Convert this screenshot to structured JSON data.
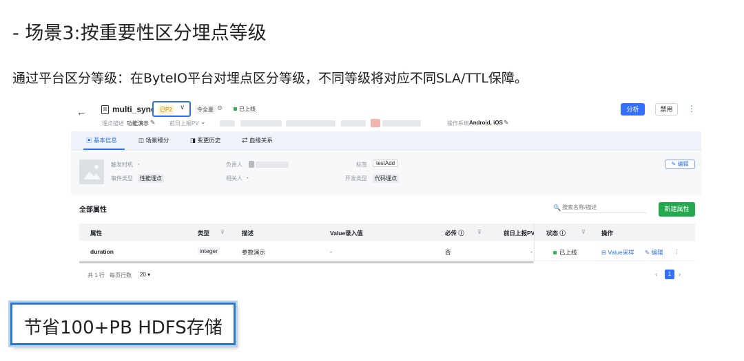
{
  "slide": {
    "title": "- 场景3:按重要性区分埋点等级",
    "subtitle": "通过平台区分等级：在ByteIO平台对埋点区分等级，不同等级将对应不同SLA/TTL保障。",
    "callout": "节省100+PB HDFS存储"
  },
  "header": {
    "back_icon": "←",
    "event_name": "multi_sync",
    "level": "已P2",
    "level_chevron": "∨",
    "scope": "令全量",
    "settings_icon": "⚙",
    "status": "已上线",
    "desc_label": "埋点描述",
    "desc_value": "功能演示",
    "pv_label": "前日上报PV",
    "pv_chevron": "⌄",
    "os_label": "操作系统",
    "os_value": "Android, iOS",
    "analyze_button": "分析",
    "disable_button": "禁用",
    "more_icon": "⋮",
    "pen_icon": "✎"
  },
  "tabs": [
    {
      "icon": "▣",
      "label": "基本信息"
    },
    {
      "icon": "◫",
      "label": "场景细分"
    },
    {
      "icon": "◨",
      "label": "变更历史"
    },
    {
      "icon": "⇄",
      "label": "血缘关系"
    }
  ],
  "info": {
    "trigger_label": "触发时机",
    "trigger_value": "-",
    "event_type_label": "事件类型",
    "event_type_value": "性能埋点",
    "owner_label": "负责人",
    "related_label": "相关人",
    "related_value": "-",
    "tag_label": "标签",
    "tag_value": "testAdd",
    "dev_type_label": "开发类型",
    "dev_type_value": "代码埋点",
    "edit_button": "✎ 编辑"
  },
  "properties": {
    "title": "全部属性",
    "search_icon": "🔍",
    "search_placeholder": "搜索名称/描述",
    "new_button": "新建属性",
    "columns": [
      "属性",
      "类型",
      "描述",
      "Value录入值",
      "必传 ⓘ",
      "前日上报PV",
      "状态 ⓘ",
      "操作"
    ],
    "filter_icon": "⊽",
    "row": {
      "name": "duration",
      "type": "integer",
      "desc": "参数演示",
      "value": "-",
      "required": "否",
      "pv": "-",
      "status": "已上线",
      "sample_link": "⊟ Value采样",
      "edit_link": "✎ 编辑",
      "more": "⋮"
    },
    "total": "共 1 行",
    "page_size_label": "每页行数",
    "page_size": "20 ▾",
    "page_prev": "‹",
    "page_current": "1",
    "page_next": "›"
  }
}
